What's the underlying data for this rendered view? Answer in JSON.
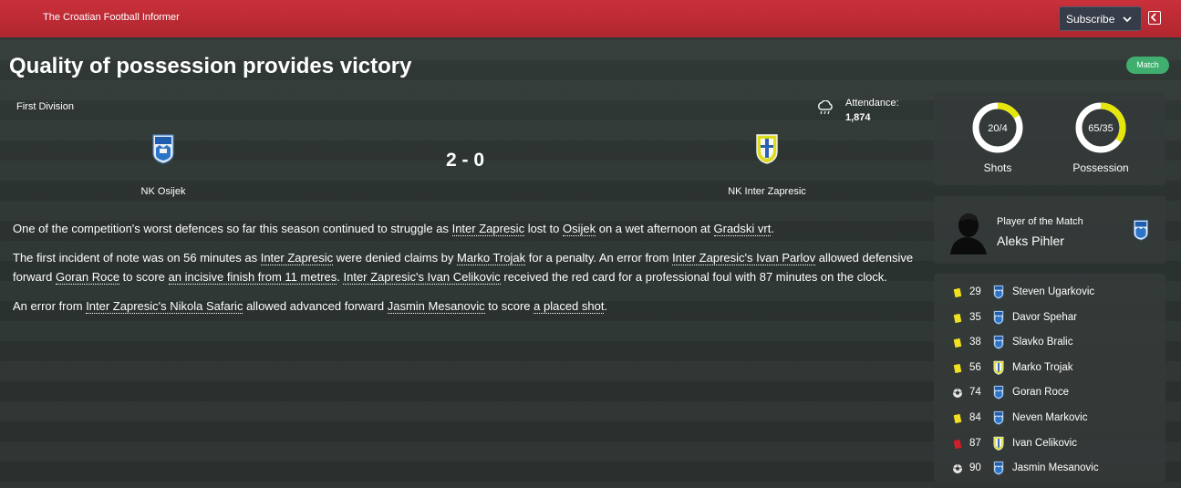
{
  "header": {
    "publication": "The Croatian Football Informer",
    "subscribe_label": "Subscribe"
  },
  "article": {
    "headline": "Quality of possession provides victory",
    "badge": "Match",
    "paragraphs": [
      [
        {
          "t": "One of the competition's worst defences so far this season continued to struggle as "
        },
        {
          "t": "Inter Zapresic",
          "link": true
        },
        {
          "t": " lost to "
        },
        {
          "t": "Osijek",
          "link": true
        },
        {
          "t": " on a wet afternoon at "
        },
        {
          "t": "Gradski vrt",
          "link": true
        },
        {
          "t": "."
        }
      ],
      [
        {
          "t": "The first incident of note was on 56 minutes as "
        },
        {
          "t": "Inter Zapresic",
          "link": true
        },
        {
          "t": " were denied claims by "
        },
        {
          "t": "Marko Trojak",
          "link": true
        },
        {
          "t": " for a penalty. An error from "
        },
        {
          "t": "Inter Zapresic's Ivan Parlov",
          "link": true
        },
        {
          "t": " allowed defensive forward "
        },
        {
          "t": "Goran Roce",
          "link": true
        },
        {
          "t": " to score "
        },
        {
          "t": "an incisive finish from 11 metres",
          "link": true
        },
        {
          "t": ". "
        },
        {
          "t": "Inter Zapresic's Ivan Celikovic",
          "link": true
        },
        {
          "t": " received the red card for a professional foul with 87 minutes on the clock."
        }
      ],
      [
        {
          "t": "An error from "
        },
        {
          "t": "Inter Zapresic's Nikola Safaric",
          "link": true
        },
        {
          "t": " allowed advanced forward "
        },
        {
          "t": "Jasmin Mesanovic",
          "link": true
        },
        {
          "t": " to score "
        },
        {
          "t": "a placed shot",
          "link": true
        },
        {
          "t": "."
        }
      ]
    ]
  },
  "match": {
    "competition": "First Division",
    "weather_icon": "rain-cloud-icon",
    "attendance_label": "Attendance:",
    "attendance_value": "1,874",
    "home_team": "NK Osijek",
    "away_team": "NK Inter Zapresic",
    "score": "2 - 0"
  },
  "stats": {
    "shots": {
      "label": "Shots",
      "text": "20/4",
      "home": 20,
      "away": 4
    },
    "possession": {
      "label": "Possession",
      "text": "65/35",
      "home": 65,
      "away": 35
    }
  },
  "player_of_match": {
    "title": "Player of the Match",
    "name": "Aleks Pihler",
    "team": "home"
  },
  "events": [
    {
      "type": "yellow",
      "icon": "yellow-card-icon",
      "minute": "29",
      "team": "home",
      "player": "Steven Ugarkovic"
    },
    {
      "type": "yellow",
      "icon": "yellow-card-icon",
      "minute": "35",
      "team": "home",
      "player": "Davor Spehar"
    },
    {
      "type": "yellow",
      "icon": "yellow-card-icon",
      "minute": "38",
      "team": "home",
      "player": "Slavko Bralic"
    },
    {
      "type": "yellow",
      "icon": "yellow-card-icon",
      "minute": "56",
      "team": "away",
      "player": "Marko Trojak"
    },
    {
      "type": "goal",
      "icon": "football-goal-icon",
      "minute": "74",
      "team": "home",
      "player": "Goran Roce"
    },
    {
      "type": "yellow",
      "icon": "yellow-card-icon",
      "minute": "84",
      "team": "home",
      "player": "Neven Markovic"
    },
    {
      "type": "red",
      "icon": "red-card-icon",
      "minute": "87",
      "team": "away",
      "player": "Ivan Celikovic"
    },
    {
      "type": "goal",
      "icon": "football-goal-icon",
      "minute": "90",
      "team": "home",
      "player": "Jasmin Mesanovic"
    }
  ],
  "colors": {
    "header_red": "#b1262f",
    "badge_green": "#3fae6e",
    "home_ring": "#ffffff",
    "away_ring": "#e6e60c",
    "yellow_card": "#f0e020",
    "red_card": "#d0202a"
  }
}
